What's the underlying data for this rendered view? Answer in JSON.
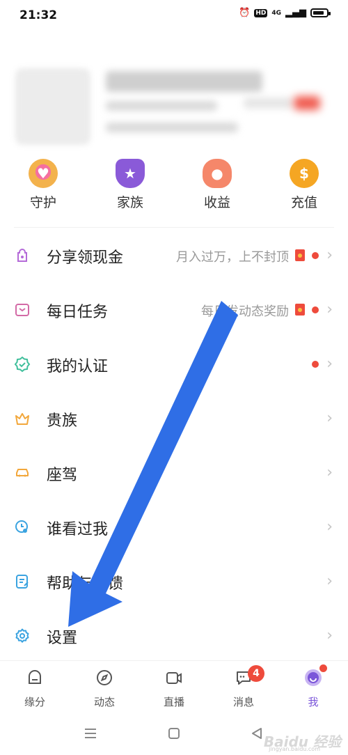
{
  "status_bar": {
    "time": "21:32",
    "hd": "HD",
    "network": "4G"
  },
  "quick_actions": [
    {
      "label": "守护",
      "icon": "guard-heart-icon",
      "color": "#f0a020"
    },
    {
      "label": "家族",
      "icon": "family-shield-icon",
      "color": "#8a5ad8"
    },
    {
      "label": "收益",
      "icon": "piggy-bank-icon",
      "color": "#f5876a"
    },
    {
      "label": "充值",
      "icon": "coin-dollar-icon",
      "color": "#f5a623"
    }
  ],
  "menu": [
    {
      "label": "分享领现金",
      "hint": "月入过万，上不封顶",
      "red_packet": true,
      "dot": true,
      "icon": "share-cash-icon"
    },
    {
      "label": "每日任务",
      "hint": "每日发动态奖励",
      "red_packet": true,
      "dot": true,
      "icon": "daily-task-icon"
    },
    {
      "label": "我的认证",
      "hint": "",
      "red_packet": false,
      "dot": true,
      "icon": "verification-icon"
    },
    {
      "label": "贵族",
      "hint": "",
      "red_packet": false,
      "dot": false,
      "icon": "crown-icon"
    },
    {
      "label": "座驾",
      "hint": "",
      "red_packet": false,
      "dot": false,
      "icon": "car-icon"
    },
    {
      "label": "谁看过我",
      "hint": "",
      "red_packet": false,
      "dot": false,
      "icon": "visitors-icon"
    },
    {
      "label": "帮助与反馈",
      "hint": "",
      "red_packet": false,
      "dot": false,
      "icon": "feedback-icon"
    },
    {
      "label": "设置",
      "hint": "",
      "red_packet": false,
      "dot": false,
      "icon": "settings-gear-icon"
    }
  ],
  "tabbar": {
    "tabs": [
      {
        "label": "缘分",
        "icon": "fate-icon"
      },
      {
        "label": "动态",
        "icon": "compass-icon"
      },
      {
        "label": "直播",
        "icon": "live-video-icon"
      },
      {
        "label": "消息",
        "icon": "message-icon",
        "badge": "4"
      },
      {
        "label": "我",
        "icon": "me-avatar-icon",
        "active": true
      }
    ]
  },
  "watermark": {
    "text": "Baidu 经验",
    "sub": "jingyan.baidu.com"
  },
  "colors": {
    "accent": "#7b56d9",
    "alert": "#ee4b3c",
    "arrow": "#2f6ee6"
  }
}
